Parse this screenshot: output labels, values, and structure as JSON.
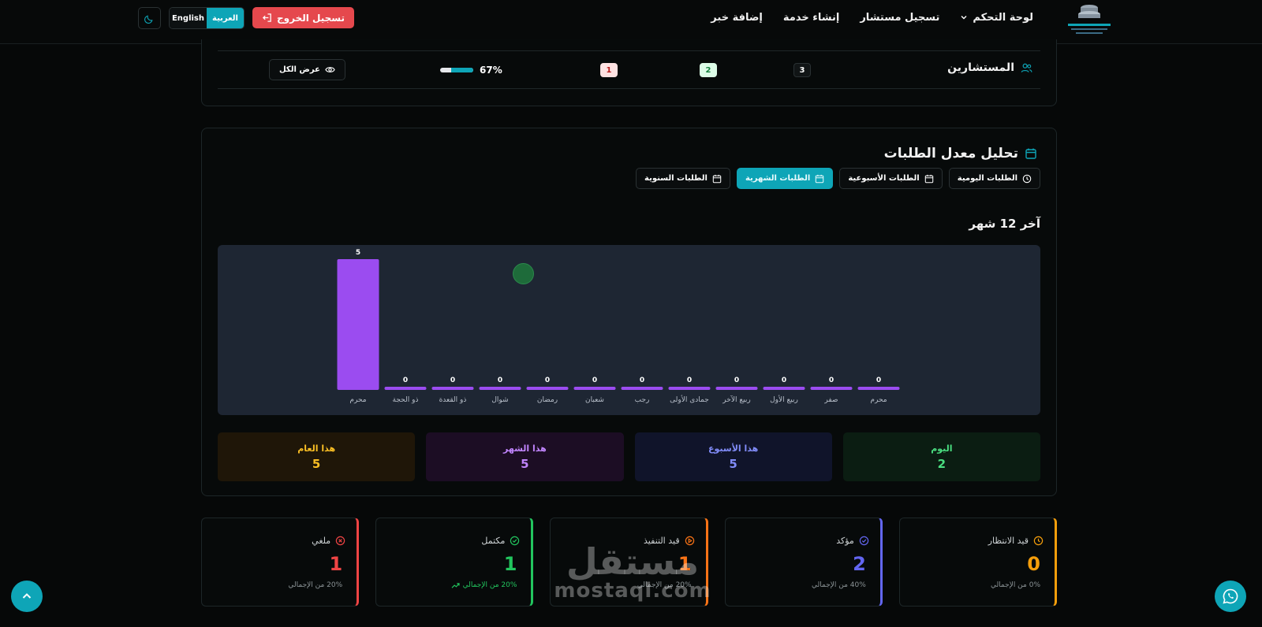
{
  "nav": {
    "items": [
      {
        "label": "لوحة التحكم",
        "has_dropdown": true
      },
      {
        "label": "تسجيل مستشار"
      },
      {
        "label": "إنشاء خدمة"
      },
      {
        "label": "إضافة خبر"
      }
    ],
    "logout_label": "تسجيل الخروج",
    "lang_ar": "العربية",
    "lang_en": "English",
    "active_lang": "ar"
  },
  "consultants_row": {
    "label": "المستشارين",
    "total": "3",
    "active": "2",
    "inactive": "1",
    "progress_text": "67%",
    "progress_value": 0.67,
    "view_all_label": "عرض الكل"
  },
  "analysis": {
    "title": "تحليل معدل الطلبات",
    "tabs": [
      {
        "label": "الطلبات اليومية",
        "icon": "clock-icon",
        "active": false
      },
      {
        "label": "الطلبات الأسبوعية",
        "icon": "calendar-icon",
        "active": false
      },
      {
        "label": "الطلبات الشهرية",
        "icon": "calendar-icon",
        "active": true
      },
      {
        "label": "الطلبات السنوية",
        "icon": "calendar-icon",
        "active": false
      }
    ],
    "range_title": "آخر 12 شهر",
    "tiles": [
      {
        "label": "اليوم",
        "value": "2",
        "color": "#4ade80",
        "bg": "#0b1d12"
      },
      {
        "label": "هذا الأسبوع",
        "value": "5",
        "color": "#818cf8",
        "bg": "#10142a"
      },
      {
        "label": "هذا الشهر",
        "value": "5",
        "color": "#c084fc",
        "bg": "#1c0d24"
      },
      {
        "label": "هذا العام",
        "value": "5",
        "color": "#fbbf24",
        "bg": "#1f1608"
      }
    ]
  },
  "chart_data": {
    "type": "bar",
    "categories": [
      "محرم",
      "صفر",
      "ربيع الأول",
      "ربيع الآخر",
      "جمادى الأولى",
      "رجب",
      "شعبان",
      "رمضان",
      "شوال",
      "ذو القعدة",
      "ذو الحجة",
      "محرم"
    ],
    "values": [
      0,
      0,
      0,
      0,
      0,
      0,
      0,
      0,
      0,
      0,
      0,
      5
    ],
    "ylim": [
      0,
      5
    ],
    "bar_color": "#9b4cf0",
    "grid": false,
    "title": "",
    "xlabel": "",
    "ylabel": ""
  },
  "status_cards": [
    {
      "label": "قيد الانتظار",
      "value": "0",
      "foot": "0% من الإجمالي",
      "color": "#f59e0b",
      "icon": "clock-icon"
    },
    {
      "label": "مؤكد",
      "value": "2",
      "foot": "40% من الإجمالي",
      "color": "#6366f1",
      "icon": "check-circle-icon"
    },
    {
      "label": "قيد التنفيذ",
      "value": "1",
      "foot": "20% من الإجمالي",
      "color": "#f97316",
      "icon": "play-circle-icon"
    },
    {
      "label": "مكتمل",
      "value": "1",
      "foot": "20% من الإجمالي",
      "color": "#22c55e",
      "icon": "check-circle-icon",
      "trend": true
    },
    {
      "label": "ملغي",
      "value": "1",
      "foot": "20% من الإجمالي",
      "color": "#ef4444",
      "icon": "x-circle-icon"
    }
  ],
  "watermark": {
    "ar": "مستقل",
    "en": "mostaql.com"
  }
}
